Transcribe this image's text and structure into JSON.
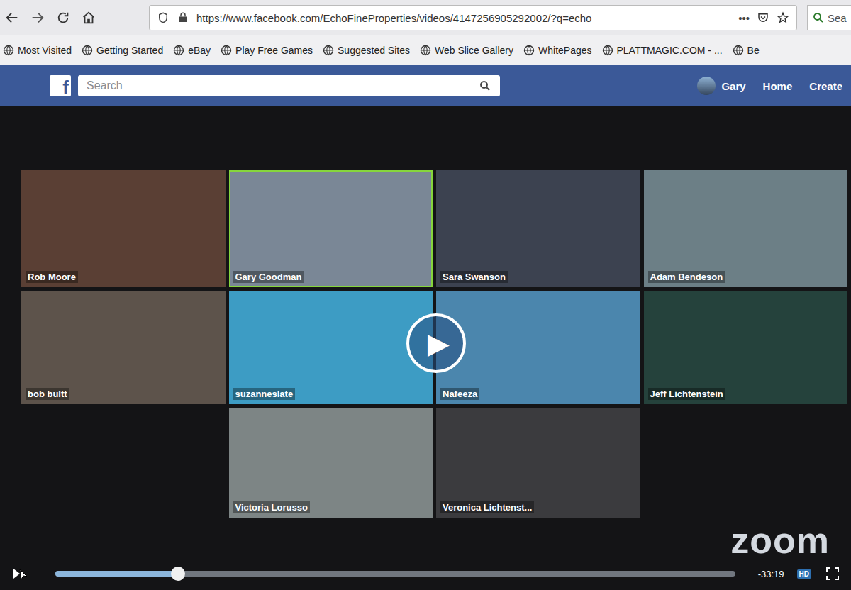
{
  "browser": {
    "url": "https://www.facebook.com/EchoFineProperties/videos/4147256905292002/?q=echo",
    "menu": "•••",
    "search": "Sea",
    "bookmarks": [
      "Most Visited",
      "Getting Started",
      "eBay",
      "Play Free Games",
      "Suggested Sites",
      "Web Slice Gallery",
      "WhitePages",
      "PLATTMAGIC.COM - ...",
      "Be"
    ]
  },
  "facebook": {
    "logo": "f",
    "search_placeholder": "Search",
    "user": "Gary",
    "nav": [
      "Home",
      "Create"
    ]
  },
  "meeting": {
    "logo": "zoom",
    "tiles": [
      {
        "name": "Rob Moore",
        "speaking": false
      },
      {
        "name": "Gary Goodman",
        "speaking": true
      },
      {
        "name": "Sara Swanson",
        "speaking": false
      },
      {
        "name": "Adam Bendeson",
        "speaking": false
      },
      {
        "name": "bob bultt",
        "speaking": false
      },
      {
        "name": "suzanneslate",
        "speaking": false
      },
      {
        "name": "Nafeeza",
        "speaking": false
      },
      {
        "name": "Jeff Lichtenstein",
        "speaking": false
      },
      {
        "name": "Victoria Lorusso",
        "speaking": false
      },
      {
        "name": "Veronica Lichtenst...",
        "speaking": false
      }
    ]
  },
  "video": {
    "play": "▶",
    "level": 0.18,
    "time": "-33:19",
    "hd": "HD"
  }
}
